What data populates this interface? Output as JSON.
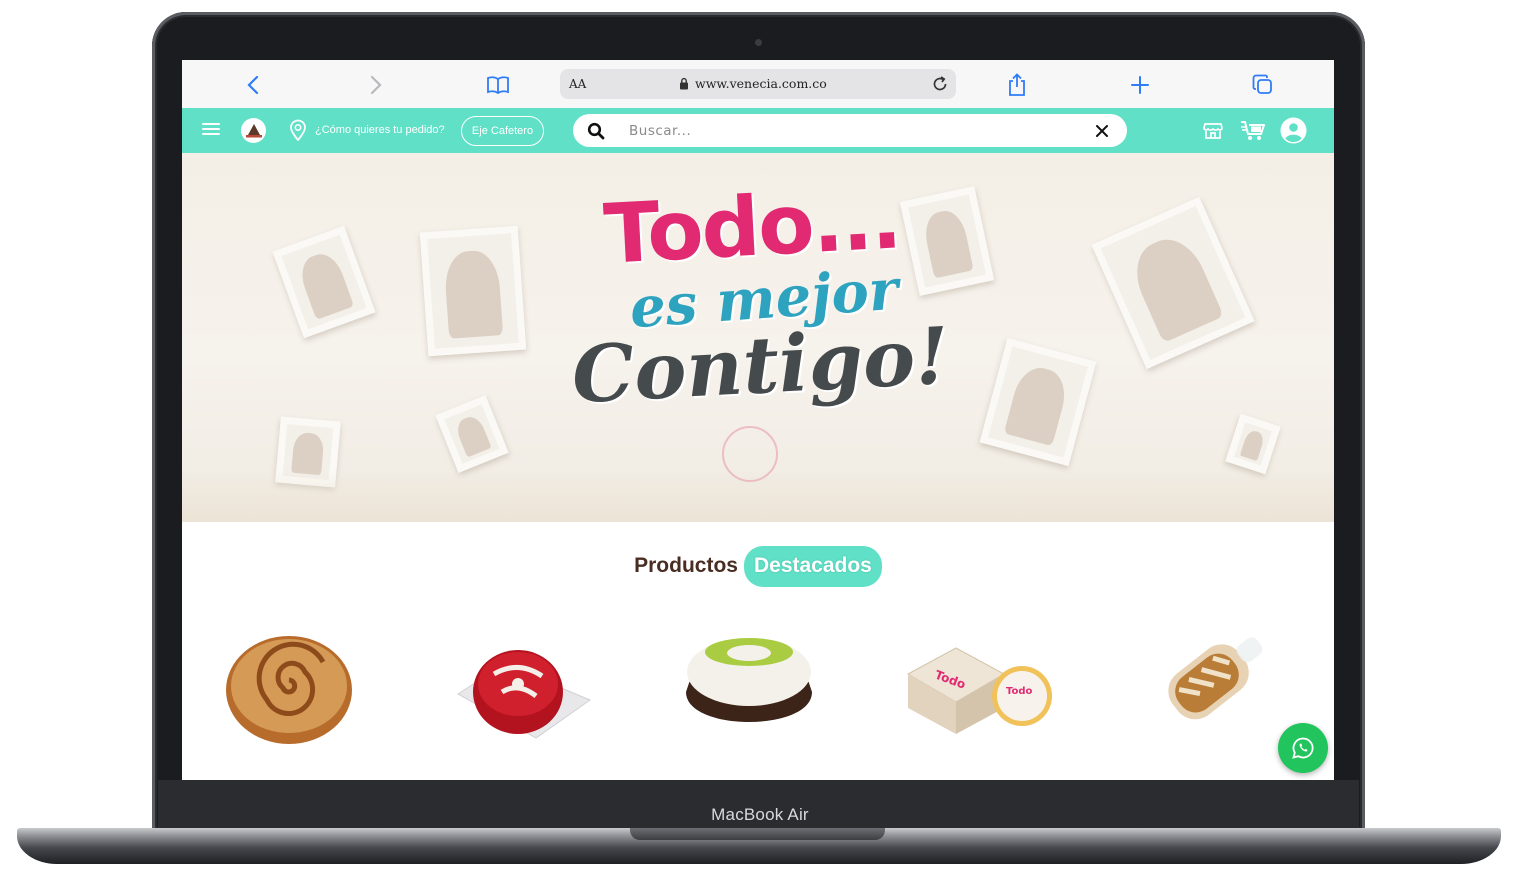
{
  "device": {
    "label": "MacBook Air"
  },
  "browser": {
    "reader_label": "AA",
    "url": "www.venecia.com.co"
  },
  "header": {
    "order_question": "¿Cómo quieres tu pedido?",
    "region": "Eje Cafetero",
    "search_placeholder": "Buscar...",
    "accent_color": "#5fe0c7"
  },
  "hero": {
    "line1": "Todo...",
    "line2": "es mejor",
    "line3": "Contigo!"
  },
  "featured": {
    "title_part1": "Productos",
    "title_part2": "Destacados",
    "products": [
      {
        "name": "cinnamon-roll"
      },
      {
        "name": "red-velvet-roll"
      },
      {
        "name": "chocolate-bundt-cake"
      },
      {
        "name": "boxed-cookie"
      },
      {
        "name": "wrapped-pastry"
      }
    ]
  }
}
